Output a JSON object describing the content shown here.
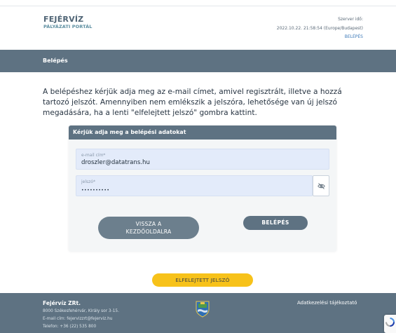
{
  "header": {
    "logo_line1": "FEJÉRVÍZ",
    "logo_line2": "PÁLYÁZATI PORTÁL",
    "server_time_label": "Szerver idő:",
    "server_time_value": "2022.10.22. 21:58:54 (Europe/Budapest)",
    "login_link": "BELÉPÉS"
  },
  "banner": {
    "title": "Belépés"
  },
  "intro_text": "A belépéshez kérjük adja meg az e-mail címet, amivel regisztrált, illetve a hozzá tartozó jelszót. Amennyiben nem emlékszik a jelszóra, lehetősége van új jelszó megadására, ha a lenti \"elfelejtett jelszó\" gombra kattint.",
  "form": {
    "heading": "Kérjük adja meg a belépési adatokat",
    "email": {
      "label": "e-mail cím*",
      "value": "droszler@datatrans.hu"
    },
    "password": {
      "label": "jelszó*",
      "value": "••••••••••"
    },
    "show_password_icon": "eye-slash-icon",
    "back_button": {
      "line1": "VISSZA A",
      "line2": "KEZDŐOLDALRA"
    },
    "login_button": "BELÉPÉS",
    "forgot_button": "ELFELEJTETT JELSZÓ"
  },
  "footer": {
    "company": "Fejérvíz ZRt.",
    "address": "8000 Székesfehérvár, Király sor 3-15.",
    "email": "E-mail cím: fejervizzrt@fejerviz.hu",
    "phone": "Telefon: +36 (22) 535 800",
    "privacy_link": "Adatkezelési tájékoztató",
    "crest_icon": "city-crest-icon"
  },
  "colors": {
    "primary": "#5e7282",
    "accent": "#f7c21a",
    "link": "#3d7ab8",
    "input_bg": "#e3ebfa"
  }
}
